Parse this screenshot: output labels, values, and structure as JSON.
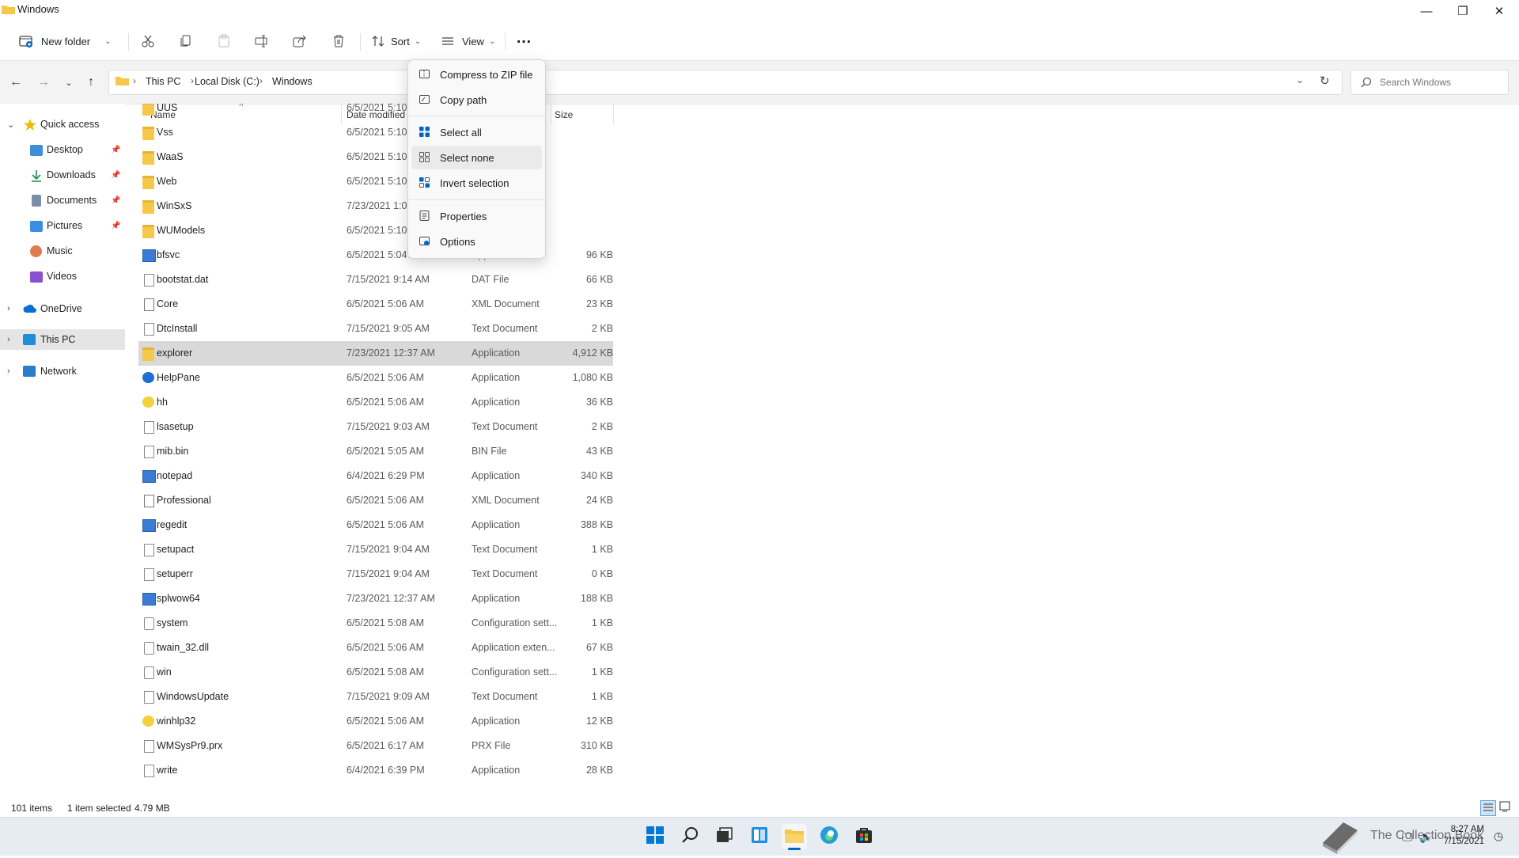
{
  "window": {
    "title": "Windows"
  },
  "toolbar": {
    "new_folder": "New folder",
    "sort": "Sort",
    "view": "View",
    "more": "…"
  },
  "address": {
    "crumbs": [
      "This PC",
      "Local Disk (C:)",
      "Windows"
    ],
    "search_placeholder": "Search Windows"
  },
  "sidebar": {
    "quick_access": "Quick access",
    "items": [
      {
        "label": "Desktop",
        "icon": "desktop-icon",
        "pinned": true
      },
      {
        "label": "Downloads",
        "icon": "download-icon",
        "pinned": true
      },
      {
        "label": "Documents",
        "icon": "documents-icon",
        "pinned": true
      },
      {
        "label": "Pictures",
        "icon": "pictures-icon",
        "pinned": true
      },
      {
        "label": "Music",
        "icon": "music-icon",
        "pinned": false
      },
      {
        "label": "Videos",
        "icon": "videos-icon",
        "pinned": false
      }
    ],
    "onedrive": "OneDrive",
    "this_pc": "This PC",
    "network": "Network"
  },
  "columns": {
    "name": "Name",
    "date": "Date modified",
    "size": "Size"
  },
  "files": [
    {
      "name": "UUS",
      "date": "6/5/2021 5:10 AM",
      "type": "",
      "size": "",
      "icon": "folder"
    },
    {
      "name": "Vss",
      "date": "6/5/2021 5:10 AM",
      "type": "",
      "size": "",
      "icon": "folder"
    },
    {
      "name": "WaaS",
      "date": "6/5/2021 5:10 AM",
      "type": "",
      "size": "",
      "icon": "folder"
    },
    {
      "name": "Web",
      "date": "6/5/2021 5:10 AM",
      "type": "",
      "size": "",
      "icon": "folder"
    },
    {
      "name": "WinSxS",
      "date": "7/23/2021 1:06 AM",
      "type": "",
      "size": "",
      "icon": "folder"
    },
    {
      "name": "WUModels",
      "date": "6/5/2021 5:10 AM",
      "type": "",
      "size": "",
      "icon": "folder"
    },
    {
      "name": "bfsvc",
      "date": "6/5/2021 5:04 AM",
      "type": "Application",
      "size": "96 KB",
      "icon": "app"
    },
    {
      "name": "bootstat.dat",
      "date": "7/15/2021 9:14 AM",
      "type": "DAT File",
      "size": "66 KB",
      "icon": "doc"
    },
    {
      "name": "Core",
      "date": "6/5/2021 5:06 AM",
      "type": "XML Document",
      "size": "23 KB",
      "icon": "xml"
    },
    {
      "name": "DtcInstall",
      "date": "7/15/2021 9:05 AM",
      "type": "Text Document",
      "size": "2 KB",
      "icon": "doc"
    },
    {
      "name": "explorer",
      "date": "7/23/2021 12:37 AM",
      "type": "Application",
      "size": "4,912 KB",
      "icon": "folder",
      "selected": true
    },
    {
      "name": "HelpPane",
      "date": "6/5/2021 5:06 AM",
      "type": "Application",
      "size": "1,080 KB",
      "icon": "help"
    },
    {
      "name": "hh",
      "date": "6/5/2021 5:06 AM",
      "type": "Application",
      "size": "36 KB",
      "icon": "yel"
    },
    {
      "name": "lsasetup",
      "date": "7/15/2021 9:03 AM",
      "type": "Text Document",
      "size": "2 KB",
      "icon": "doc"
    },
    {
      "name": "mib.bin",
      "date": "6/5/2021 5:05 AM",
      "type": "BIN File",
      "size": "43 KB",
      "icon": "doc"
    },
    {
      "name": "notepad",
      "date": "6/4/2021 6:29 PM",
      "type": "Application",
      "size": "340 KB",
      "icon": "app"
    },
    {
      "name": "Professional",
      "date": "6/5/2021 5:06 AM",
      "type": "XML Document",
      "size": "24 KB",
      "icon": "xml"
    },
    {
      "name": "regedit",
      "date": "6/5/2021 5:06 AM",
      "type": "Application",
      "size": "388 KB",
      "icon": "app"
    },
    {
      "name": "setupact",
      "date": "7/15/2021 9:04 AM",
      "type": "Text Document",
      "size": "1 KB",
      "icon": "doc"
    },
    {
      "name": "setuperr",
      "date": "7/15/2021 9:04 AM",
      "type": "Text Document",
      "size": "0 KB",
      "icon": "doc"
    },
    {
      "name": "splwow64",
      "date": "7/23/2021 12:37 AM",
      "type": "Application",
      "size": "188 KB",
      "icon": "app"
    },
    {
      "name": "system",
      "date": "6/5/2021 5:08 AM",
      "type": "Configuration sett...",
      "size": "1 KB",
      "icon": "gear"
    },
    {
      "name": "twain_32.dll",
      "date": "6/5/2021 5:06 AM",
      "type": "Application exten...",
      "size": "67 KB",
      "icon": "gear"
    },
    {
      "name": "win",
      "date": "6/5/2021 5:08 AM",
      "type": "Configuration sett...",
      "size": "1 KB",
      "icon": "gear"
    },
    {
      "name": "WindowsUpdate",
      "date": "7/15/2021 9:09 AM",
      "type": "Text Document",
      "size": "1 KB",
      "icon": "doc"
    },
    {
      "name": "winhlp32",
      "date": "6/5/2021 5:06 AM",
      "type": "Application",
      "size": "12 KB",
      "icon": "yel"
    },
    {
      "name": "WMSysPr9.prx",
      "date": "6/5/2021 6:17 AM",
      "type": "PRX File",
      "size": "310 KB",
      "icon": "doc"
    },
    {
      "name": "write",
      "date": "6/4/2021 6:39 PM",
      "type": "Application",
      "size": "28 KB",
      "icon": "doc"
    }
  ],
  "context_menu": {
    "compress": "Compress to ZIP file",
    "copy_path": "Copy path",
    "select_all": "Select all",
    "select_none": "Select none",
    "invert": "Invert selection",
    "properties": "Properties",
    "options": "Options"
  },
  "status": {
    "items": "101 items",
    "selected": "1 item selected",
    "size": "4.79 MB"
  },
  "watermark": "The Collection Book",
  "clock": {
    "time": "8:27 AM",
    "date": "7/15/2021"
  },
  "colors": {
    "accent": "#0067c0",
    "folder": "#f5c84a"
  }
}
